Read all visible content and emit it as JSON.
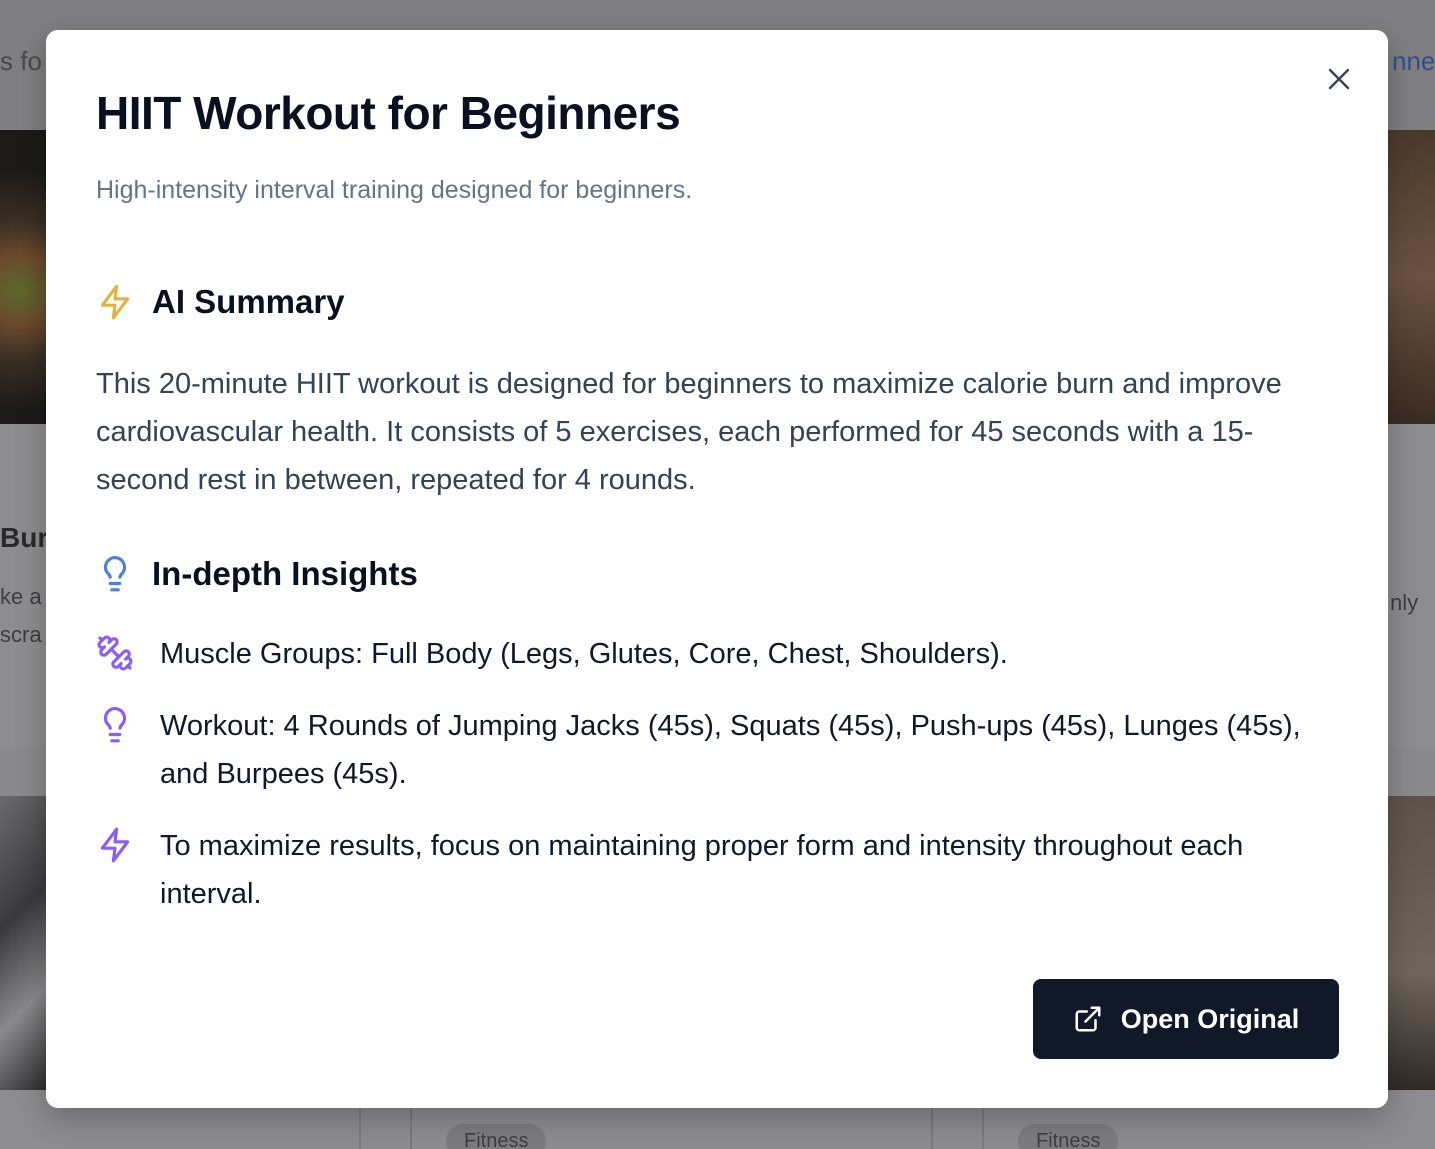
{
  "background": {
    "header_left_text": "s fo",
    "header_right_text": "nne",
    "card_left_title": "Burg",
    "card_left_line1": "ke a",
    "card_left_line2": "scra",
    "card_right_line": "nly",
    "pill_1": "Fitness",
    "pill_2": "Fitness"
  },
  "modal": {
    "title": "HIIT Workout for Beginners",
    "subtitle": "High-intensity interval training designed for beginners.",
    "close_icon": "close-icon",
    "summary": {
      "heading": "AI Summary",
      "icon": "lightning-icon",
      "icon_color": "#e3b341",
      "text": "This 20-minute HIIT workout is designed for beginners to maximize calorie burn and improve cardiovascular health. It consists of 5 exercises, each performed for 45 seconds with a 15-second rest in between, repeated for 4 rounds."
    },
    "insights": {
      "heading": "In-depth Insights",
      "icon": "lightbulb-icon",
      "icon_color": "#4f7fd9",
      "items": [
        {
          "icon": "dumbbell-icon",
          "text": "Muscle Groups: Full Body (Legs, Glutes, Core, Chest, Shoulders)."
        },
        {
          "icon": "lightbulb-icon",
          "text": "Workout: 4 Rounds of Jumping Jacks (45s), Squats (45s), Push-ups (45s), Lunges (45s), and Burpees (45s)."
        },
        {
          "icon": "lightning-icon",
          "text": "To maximize results, focus on maintaining proper form and intensity throughout each interval."
        }
      ],
      "item_icon_color": "#8b5cf6"
    },
    "open_button": {
      "label": "Open Original",
      "icon": "external-link-icon"
    }
  },
  "colors": {
    "button_bg": "#111827",
    "title": "#0b1020",
    "subtitle": "#6b7280"
  }
}
